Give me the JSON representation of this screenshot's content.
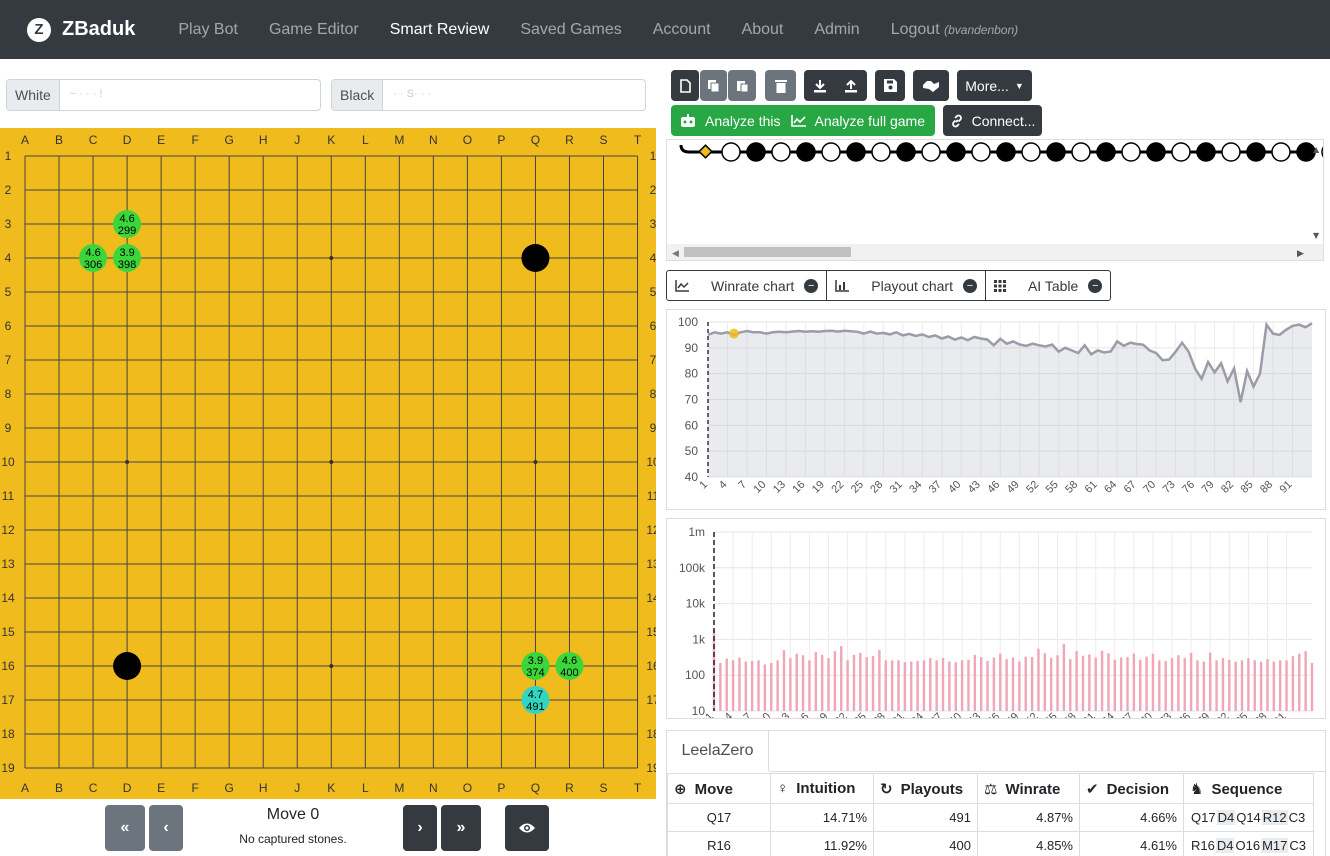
{
  "brand": {
    "logo": "Z",
    "name": "ZBaduk"
  },
  "nav": [
    {
      "label": "Play Bot",
      "active": false
    },
    {
      "label": "Game Editor",
      "active": false
    },
    {
      "label": "Smart Review",
      "active": true
    },
    {
      "label": "Saved Games",
      "active": false
    },
    {
      "label": "Account",
      "active": false
    },
    {
      "label": "About",
      "active": false
    },
    {
      "label": "Admin",
      "active": false
    }
  ],
  "logout": {
    "label": "Logout",
    "user": "(bvandenbon)"
  },
  "players": {
    "white_label": "White",
    "white_value": "~ · · ·  !",
    "black_label": "Black",
    "black_value": "· · S· ·  ·"
  },
  "board": {
    "columns": [
      "A",
      "B",
      "C",
      "D",
      "E",
      "F",
      "G",
      "H",
      "J",
      "K",
      "L",
      "M",
      "N",
      "O",
      "P",
      "Q",
      "R",
      "S",
      "T"
    ],
    "rows": [
      "1",
      "2",
      "3",
      "4",
      "5",
      "6",
      "7",
      "8",
      "9",
      "10",
      "11",
      "12",
      "13",
      "14",
      "15",
      "16",
      "17",
      "18",
      "19"
    ],
    "color": "#f0bb1d",
    "stones": [
      {
        "pos": "Q4",
        "color": "black"
      },
      {
        "pos": "D16",
        "color": "black"
      }
    ],
    "hints": [
      {
        "pos": "D3",
        "score": "4.6",
        "visits": "299",
        "color": "#3bd63b"
      },
      {
        "pos": "C4",
        "score": "4.6",
        "visits": "306",
        "color": "#3bd63b"
      },
      {
        "pos": "D4",
        "score": "3.9",
        "visits": "398",
        "color": "#3bd63b"
      },
      {
        "pos": "Q16",
        "score": "3.9",
        "visits": "374",
        "color": "#3bd63b"
      },
      {
        "pos": "R16",
        "score": "4.6",
        "visits": "400",
        "color": "#3bd63b"
      },
      {
        "pos": "Q17",
        "score": "4.7",
        "visits": "491",
        "color": "#30d6c0"
      }
    ]
  },
  "controls": {
    "first": "«",
    "prev": "‹",
    "next": "›",
    "last": "»",
    "move_label": "Move 0",
    "captured": "No captured stones.",
    "eye_icon": "eye-icon"
  },
  "toolbar": {
    "more": "More...",
    "analyze_this": "Analyze this",
    "analyze_full": "Analyze full game",
    "connect": "Connect..."
  },
  "tree": {
    "moves": [
      "white",
      "black",
      "white",
      "black",
      "white",
      "black",
      "white",
      "black",
      "white",
      "black",
      "white",
      "black",
      "white",
      "black",
      "white",
      "black",
      "white",
      "black",
      "white",
      "black",
      "white",
      "black",
      "white",
      "black",
      "white",
      "black"
    ]
  },
  "tabs": [
    {
      "label": "Winrate chart"
    },
    {
      "label": "Playout chart"
    },
    {
      "label": "AI Table"
    }
  ],
  "winrate_chart": {
    "type": "line",
    "ylim": [
      40,
      100
    ],
    "yticks": [
      "100",
      "90",
      "80",
      "70",
      "60",
      "50",
      "40"
    ],
    "xticks": [
      "1",
      "4",
      "7",
      "10",
      "13",
      "16",
      "19",
      "22",
      "25",
      "28",
      "31",
      "34",
      "37",
      "40",
      "43",
      "46",
      "49",
      "52",
      "55",
      "58",
      "61",
      "64",
      "67",
      "70",
      "73",
      "76",
      "79",
      "82",
      "85",
      "88",
      "91"
    ],
    "values": [
      95,
      96,
      95.5,
      96,
      95,
      96,
      96.5,
      96,
      96,
      95.5,
      96,
      96.2,
      96,
      96.3,
      96.5,
      96.2,
      96.4,
      96.2,
      96.5,
      96.6,
      96.3,
      96.6,
      96.4,
      96.2,
      95.5,
      96.3,
      95.5,
      95.8,
      95.2,
      96,
      94.8,
      95.4,
      94.6,
      95.2,
      94.2,
      94.8,
      93.6,
      94.4,
      93.2,
      94,
      93,
      94.2,
      93.6,
      93.2,
      91,
      93.5,
      91.6,
      92.5,
      91.3,
      90.8,
      91.6,
      91,
      90.5,
      91.3,
      88.5,
      90,
      89,
      88,
      91,
      87.5,
      89,
      88.2,
      88.6,
      92.5,
      90.8,
      92,
      91.5,
      91.2,
      89,
      88,
      85.2,
      85.5,
      88.5,
      92,
      88.5,
      82,
      78,
      84.5,
      80.5,
      84,
      77,
      82,
      69,
      81,
      75,
      80,
      99,
      95.5,
      95,
      97,
      98.5,
      99,
      98,
      99.5
    ],
    "marker": {
      "x": 5,
      "y": 95.5
    }
  },
  "playout_chart": {
    "type": "bar",
    "yticks": [
      "1m",
      "100k",
      "10k",
      "1k",
      "100",
      "10"
    ],
    "xticks": [
      "1",
      "4",
      "7",
      "10",
      "13",
      "16",
      "19",
      "22",
      "25",
      "28",
      "31",
      "34",
      "37",
      "40",
      "43",
      "46",
      "49",
      "52",
      "55",
      "58",
      "61",
      "64",
      "67",
      "70",
      "73",
      "76",
      "79",
      "82",
      "85",
      "88",
      "91"
    ],
    "values": [
      1900,
      220,
      290,
      260,
      310,
      240,
      250,
      260,
      200,
      220,
      260,
      500,
      300,
      400,
      360,
      260,
      440,
      370,
      300,
      470,
      650,
      260,
      370,
      420,
      320,
      340,
      500,
      260,
      260,
      260,
      230,
      240,
      250,
      260,
      300,
      260,
      300,
      240,
      230,
      260,
      270,
      370,
      320,
      250,
      310,
      400,
      280,
      310,
      240,
      330,
      320,
      550,
      410,
      300,
      360,
      750,
      280,
      470,
      350,
      380,
      310,
      480,
      410,
      270,
      310,
      320,
      400,
      270,
      330,
      400,
      260,
      250,
      300,
      360,
      300,
      420,
      260,
      240,
      430,
      260,
      300,
      270,
      240,
      260,
      300,
      260,
      240,
      280,
      240,
      260,
      260,
      340,
      400,
      470,
      220
    ]
  },
  "ai": {
    "engine_tab": "LeelaZero",
    "headers": {
      "move": "Move",
      "intuition": "Intuition",
      "playouts": "Playouts",
      "winrate": "Winrate",
      "decision": "Decision",
      "sequence": "Sequence"
    },
    "rows": [
      {
        "move": "Q17",
        "intuition": "14.71%",
        "playouts": "491",
        "winrate": "4.87%",
        "decision": "4.66%",
        "sequence": [
          "Q17",
          "D4",
          "Q14",
          "R12",
          "C3"
        ]
      },
      {
        "move": "R16",
        "intuition": "11.92%",
        "playouts": "400",
        "winrate": "4.85%",
        "decision": "4.61%",
        "sequence": [
          "R16",
          "D4",
          "O16",
          "M17",
          "C3"
        ]
      }
    ]
  }
}
